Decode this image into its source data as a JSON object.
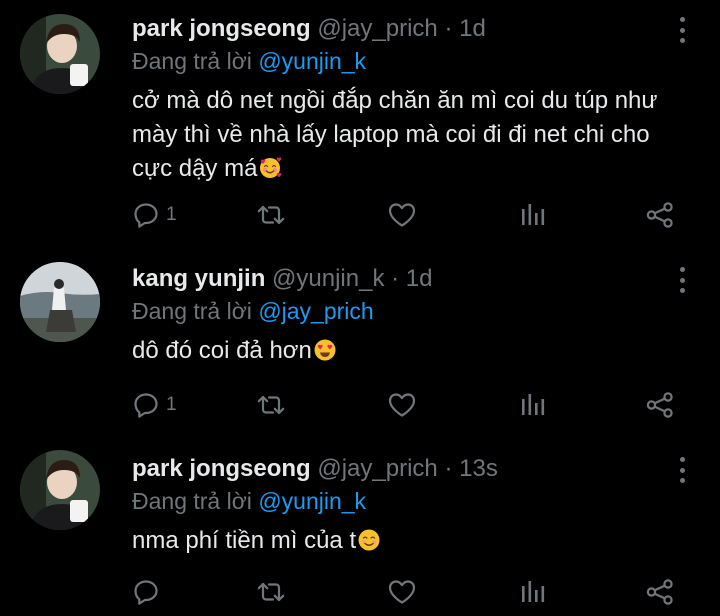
{
  "reply_prefix": "Đang trả lời",
  "tweets": [
    {
      "name": "park jongseong",
      "handle": "@jay_prich",
      "separator": "·",
      "time": "1d",
      "reply_to": "@yunjin_k",
      "text": "cở mà dô net ngồi đắp chăn ăn mì coi du túp như mày thì về nhà lấy laptop mà coi đi đi net chi cho cực dậy má",
      "emoji": "smiling-face-with-hearts",
      "reply_count": "1"
    },
    {
      "name": "kang yunjin",
      "handle": "@yunjin_k",
      "separator": "·",
      "time": "1d",
      "reply_to": "@jay_prich",
      "text": "dô đó coi đả hơn",
      "emoji": "heart-eyes",
      "reply_count": "1"
    },
    {
      "name": "park jongseong",
      "handle": "@jay_prich",
      "separator": "·",
      "time": "13s",
      "reply_to": "@yunjin_k",
      "text": "nma phí tiền mì của t",
      "emoji": "smiling-face",
      "reply_count": ""
    }
  ],
  "colors": {
    "background": "#000000",
    "primary_text": "#e7e9ea",
    "secondary_text": "#71767b",
    "accent": "#1d9bf0"
  },
  "icons": [
    "reply-icon",
    "retweet-icon",
    "like-icon",
    "views-icon",
    "share-icon",
    "more-icon"
  ]
}
